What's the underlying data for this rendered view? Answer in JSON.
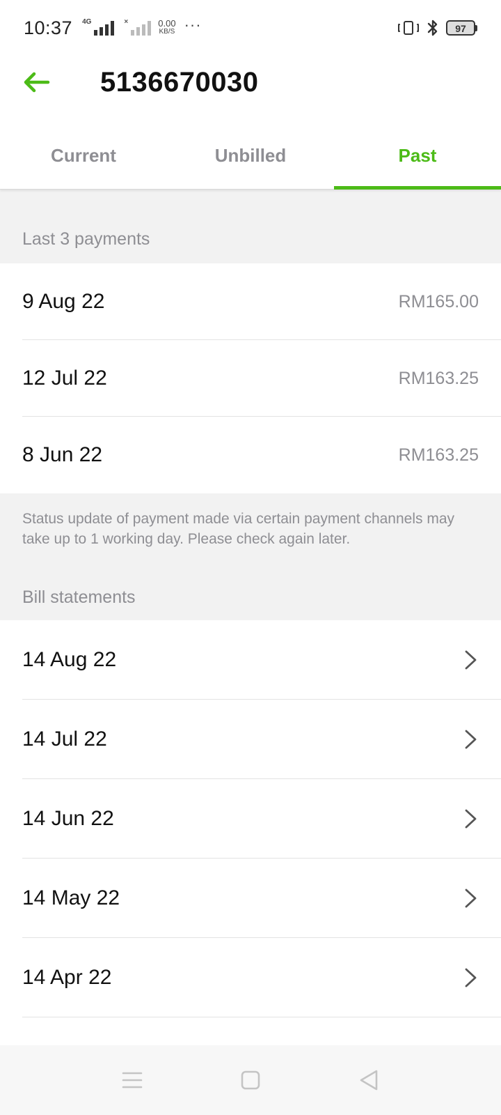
{
  "status_bar": {
    "time": "10:37",
    "network_type": "4G",
    "net_speed_value": "0.00",
    "net_speed_unit": "KB/S",
    "more": "···",
    "battery": "97"
  },
  "header": {
    "title": "5136670030",
    "accent_color": "#4cbb17"
  },
  "tabs": [
    {
      "label": "Current",
      "active": false
    },
    {
      "label": "Unbilled",
      "active": false
    },
    {
      "label": "Past",
      "active": true
    }
  ],
  "payments": {
    "heading": "Last 3 payments",
    "items": [
      {
        "date": "9 Aug 22",
        "amount": "RM165.00"
      },
      {
        "date": "12 Jul 22",
        "amount": "RM163.25"
      },
      {
        "date": "8 Jun 22",
        "amount": "RM163.25"
      }
    ],
    "note": "Status update of payment made via certain payment channels may take up to 1 working day. Please check again later."
  },
  "bills": {
    "heading": "Bill statements",
    "items": [
      {
        "date": "14 Aug 22"
      },
      {
        "date": "14 Jul 22"
      },
      {
        "date": "14 Jun 22"
      },
      {
        "date": "14 May 22"
      },
      {
        "date": "14 Apr 22"
      }
    ]
  },
  "icons": {
    "back": "arrow-left-icon",
    "row_action": "chevron-right-icon",
    "nav": [
      "menu-icon",
      "home-square-icon",
      "back-triangle-icon"
    ]
  }
}
